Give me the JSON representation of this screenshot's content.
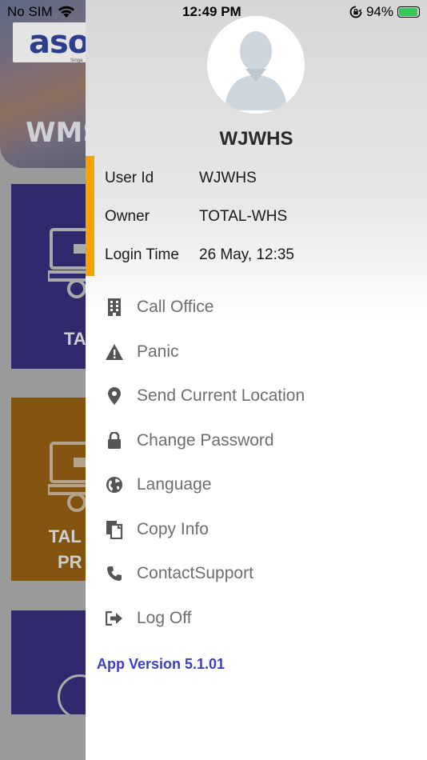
{
  "status_bar": {
    "carrier": "No SIM",
    "time": "12:49 PM",
    "battery_text": "94%",
    "battery_level": 0.94
  },
  "background_app": {
    "logo": "aso",
    "logo_sub": "Singa",
    "banner_text": "WMS",
    "tile_1_label": "TA",
    "tile_2_label_line1": "TAL",
    "tile_2_label_line2": "PR"
  },
  "profile": {
    "name": "WJWHS",
    "info": [
      {
        "label": "User Id",
        "value": "WJWHS"
      },
      {
        "label": "Owner",
        "value": "TOTAL-WHS"
      },
      {
        "label": "Login Time",
        "value": "26 May, 12:35"
      }
    ]
  },
  "menu": [
    {
      "label": "Call Office",
      "icon": "building-icon"
    },
    {
      "label": "Panic",
      "icon": "warning-icon"
    },
    {
      "label": "Send Current Location",
      "icon": "location-pin-icon"
    },
    {
      "label": "Change Password",
      "icon": "lock-icon"
    },
    {
      "label": "Language",
      "icon": "globe-icon"
    },
    {
      "label": "Copy Info",
      "icon": "copy-icon"
    },
    {
      "label": "ContactSupport",
      "icon": "phone-icon"
    },
    {
      "label": "Log Off",
      "icon": "logout-icon"
    }
  ],
  "app_version": "App Version 5.1.01",
  "colors": {
    "accent": "#f5a300",
    "version_text": "#3d3fbf",
    "menu_text": "#6e6e6e",
    "icon": "#555555"
  }
}
